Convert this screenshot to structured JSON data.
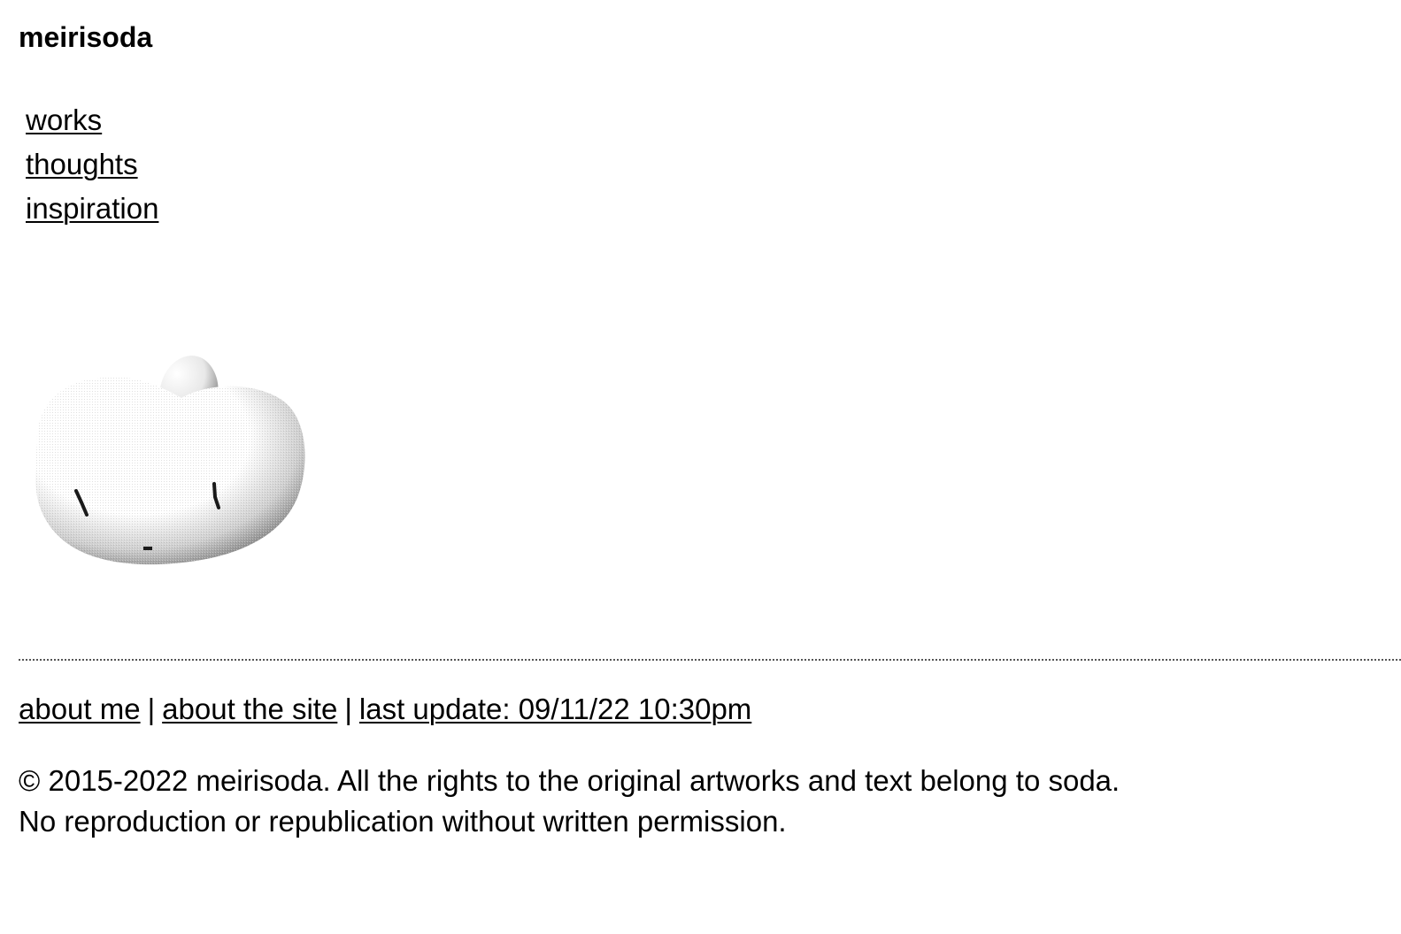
{
  "header": {
    "title": "meirisoda"
  },
  "nav": {
    "items": [
      {
        "label": "works"
      },
      {
        "label": "thoughts"
      },
      {
        "label": "inspiration"
      }
    ]
  },
  "mascot": {
    "icon": "dithered-blob-creature-icon",
    "colors": {
      "light": "#ffffff",
      "mid": "#c8c8c8",
      "dark": "#6e6e6e",
      "ink": "#1a1a1a"
    }
  },
  "footer": {
    "links": {
      "about_me": "about me",
      "about_site": "about the site",
      "last_update": "last update: 09/11/22 10:30pm"
    },
    "separator": "|",
    "copyright_line1": "© 2015-2022 meirisoda. All the rights to the original artworks and text belong to soda.",
    "copyright_line2": "No reproduction or republication without written permission."
  }
}
